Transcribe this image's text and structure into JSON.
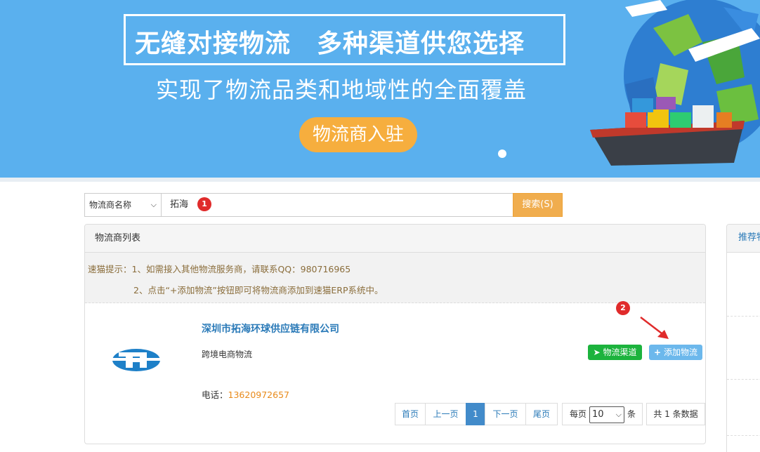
{
  "banner": {
    "title": "无缝对接物流　多种渠道供您选择",
    "subtitle": "实现了物流品类和地域性的全面覆盖",
    "cta_label": "物流商入驻",
    "colors": {
      "background": "#5ab0ee",
      "cta": "#f6ae3e"
    }
  },
  "search": {
    "select_value": "物流商名称",
    "input_value": "拓海",
    "button_label": "搜索(S)",
    "marker": "1"
  },
  "panel": {
    "heading": "物流商列表",
    "tip_line1": "速猫提示：1、如需接入其他物流服务商，请联系QQ：980716965",
    "tip_line2": "2、点击“+添加物流”按钮即可将物流商添加到速猫ERP系统中。"
  },
  "company": {
    "name": "深圳市拓海环球供应链有限公司",
    "type": "跨境电商物流",
    "phone_label": "电话：",
    "phone": "13620972657",
    "logo_icon": "tuohai-logo-icon"
  },
  "actions": {
    "channel_label": "物流渠道",
    "add_label": "添加物流",
    "marker": "2",
    "colors": {
      "channel": "#1cb33d",
      "add": "#6cb8ec"
    }
  },
  "pagination": {
    "first": "首页",
    "prev": "上一页",
    "current": "1",
    "next": "下一页",
    "last": "尾页",
    "per_page_label": "每页",
    "per_page_value": "10",
    "per_page_unit": "条",
    "total": "共 1 条数据"
  },
  "side_panel": {
    "heading": "推荐物"
  }
}
